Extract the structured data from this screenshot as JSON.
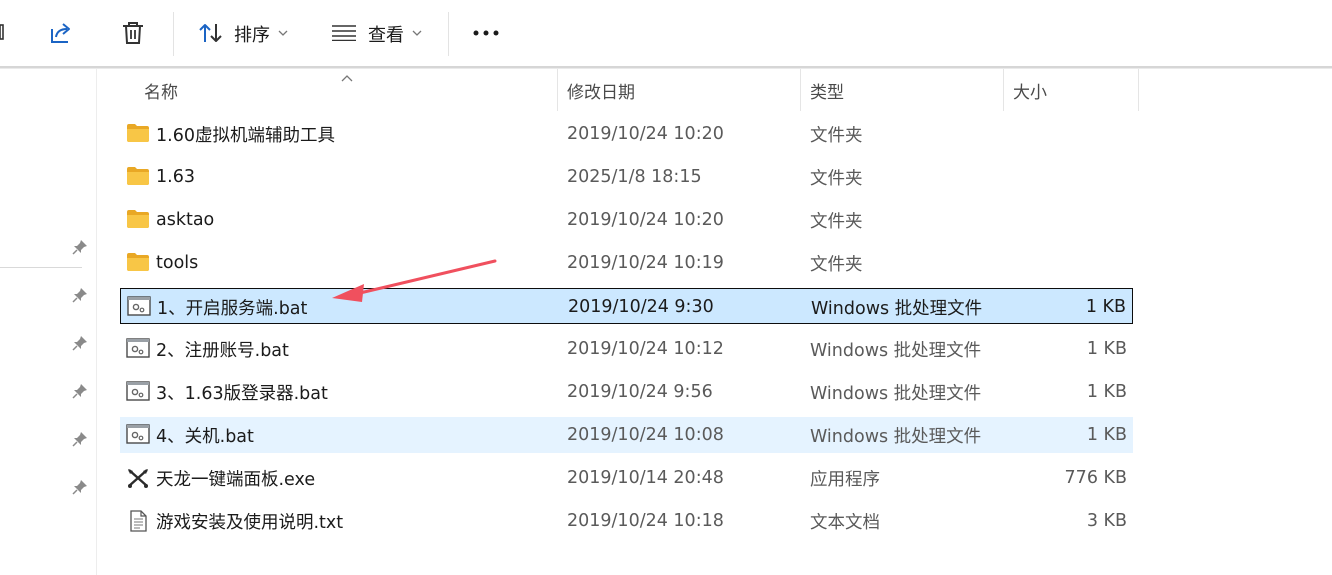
{
  "toolbar": {
    "sort_label": "排序",
    "view_label": "查看",
    "more_label": "•••"
  },
  "columns": {
    "name": "名称",
    "date": "修改日期",
    "type": "类型",
    "size": "大小"
  },
  "files": [
    {
      "name": "1.60虚拟机端辅助工具",
      "date": "2019/10/24 10:20",
      "type": "文件夹",
      "size": "",
      "icon": "folder-icon",
      "state": ""
    },
    {
      "name": "1.63",
      "date": "2025/1/8 18:15",
      "type": "文件夹",
      "size": "",
      "icon": "folder-icon",
      "state": ""
    },
    {
      "name": "asktao",
      "date": "2019/10/24 10:20",
      "type": "文件夹",
      "size": "",
      "icon": "folder-icon",
      "state": ""
    },
    {
      "name": "tools",
      "date": "2019/10/24 10:19",
      "type": "文件夹",
      "size": "",
      "icon": "folder-icon",
      "state": ""
    },
    {
      "name": "1、开启服务端.bat",
      "date": "2019/10/24 9:30",
      "type": "Windows 批处理文件",
      "size": "1 KB",
      "icon": "batch-file-icon",
      "state": "selected"
    },
    {
      "name": "2、注册账号.bat",
      "date": "2019/10/24 10:12",
      "type": "Windows 批处理文件",
      "size": "1 KB",
      "icon": "batch-file-icon",
      "state": ""
    },
    {
      "name": "3、1.63版登录器.bat",
      "date": "2019/10/24 9:56",
      "type": "Windows 批处理文件",
      "size": "1 KB",
      "icon": "batch-file-icon",
      "state": ""
    },
    {
      "name": "4、关机.bat",
      "date": "2019/10/24 10:08",
      "type": "Windows 批处理文件",
      "size": "1 KB",
      "icon": "batch-file-icon",
      "state": "hover"
    },
    {
      "name": "天龙一键端面板.exe",
      "date": "2019/10/14 20:48",
      "type": "应用程序",
      "size": "776 KB",
      "icon": "executable-icon",
      "state": ""
    },
    {
      "name": "游戏安装及使用说明.txt",
      "date": "2019/10/24 10:18",
      "type": "文本文档",
      "size": "3 KB",
      "icon": "text-document-icon",
      "state": ""
    }
  ],
  "colors": {
    "selected_bg": "#cce8ff",
    "hover_bg": "#e5f3ff",
    "folder": "#f8c646",
    "annotation_arrow": "#f0505e"
  }
}
